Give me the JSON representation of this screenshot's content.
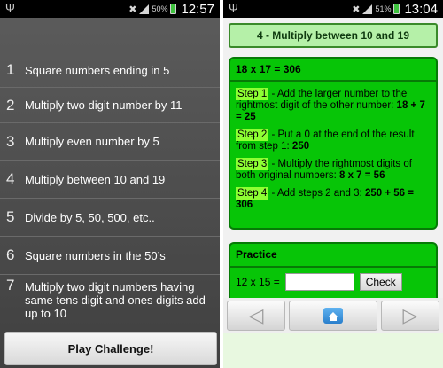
{
  "left_screen": {
    "status": {
      "battery_pct": "50%",
      "time": "12:57"
    },
    "menu": [
      {
        "num": "1",
        "label": "Square numbers ending in 5"
      },
      {
        "num": "2",
        "label": "Multiply two digit number by 11"
      },
      {
        "num": "3",
        "label": "Multiply even number by 5"
      },
      {
        "num": "4",
        "label": "Multiply between 10 and 19"
      },
      {
        "num": "5",
        "label": "Divide by 5, 50, 500, etc.."
      },
      {
        "num": "6",
        "label": "Square numbers in the 50’s"
      },
      {
        "num": "7",
        "label": "Multiply two digit numbers having same tens digit and ones digits add up to 10"
      }
    ],
    "play_label": "Play Challenge!"
  },
  "right_screen": {
    "status": {
      "battery_pct": "51%",
      "time": "13:04"
    },
    "title": "4 - Multiply between 10 and 19",
    "problem": "18 x 17 = 306",
    "steps": [
      {
        "tag": "Step 1",
        "text": " - Add the larger number to the rightmost digit of the other number: ",
        "bold": "18 + 7 = 25"
      },
      {
        "tag": "Step 2",
        "text": " - Put a 0 at the end of the result from step 1: ",
        "bold": "250"
      },
      {
        "tag": "Step 3",
        "text": " - Multiply the rightmost digits of both original numbers: ",
        "bold": "8 x 7 = 56"
      },
      {
        "tag": "Step 4",
        "text": " - Add steps 2 and 3: ",
        "bold": "250 + 56 = 306"
      }
    ],
    "practice": {
      "title": "Practice",
      "question": "12 x 15 =",
      "answer": "",
      "check_label": "Check"
    },
    "nav": {
      "prev": "◁",
      "next": "▷"
    }
  },
  "icons": {
    "usb": "usb-icon",
    "mute": "mute-icon",
    "signal": "signal-icon",
    "battery": "battery-icon",
    "home": "home-icon"
  },
  "colors": {
    "panel_green": "#07c507",
    "step_tag": "#8dff33",
    "title_bg": "#b5f0a8"
  }
}
